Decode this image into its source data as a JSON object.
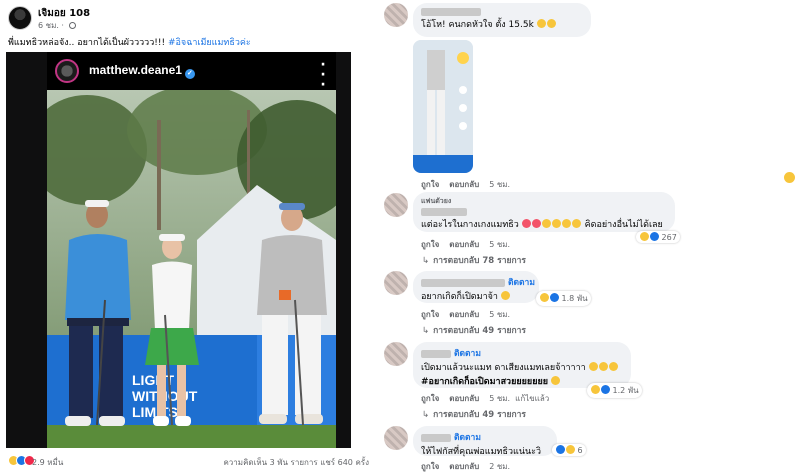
{
  "post": {
    "author": "เจิมอย 108",
    "time": "6 ชม.",
    "caption_text": "พี่แมทธิวหล่อจัง.. อยากได้เป็นผัววววว!!! ",
    "hashtag": "#อิจฉาเมียแมทธิวค่ะ",
    "ig_username": "matthew.deane1",
    "banner_line1": "LIGHT",
    "banner_line2": "WITHOUT",
    "banner_line3": "LIMITS",
    "reactions_count": "2.9 หมื่น",
    "stats": "ความคิดเห็น 3 พัน รายการ  แชร์ 640 ครั้ง"
  },
  "comments": [
    {
      "text": "โอ้โห! คนกดหัวใจ ตั้ง 15.5k",
      "like": "ถูกใจ",
      "reply": "ตอบกลับ",
      "time": "5 ชม."
    },
    {
      "badge": "แฟนตัวยง",
      "text": "แต่อะไรในกางเกงแมทธิว",
      "text_after": "คิดอย่างอื่นไม่ได้เลย",
      "reactions": "267",
      "like": "ถูกใจ",
      "reply": "ตอบกลับ",
      "time": "5 ชม.",
      "replies": "การตอบกลับ 78 รายการ"
    },
    {
      "follow": "ติดตาม",
      "text": "อยากเกิดก็เปิดมาจ้า",
      "reactions": "1.8 พัน",
      "like": "ถูกใจ",
      "reply": "ตอบกลับ",
      "time": "5 ชม.",
      "replies": "การตอบกลับ 49 รายการ"
    },
    {
      "follow": "ติดตาม",
      "text": "เปิดมาแล้วนะแมท ดาเสียงแมทเลยจ้าาาาา",
      "text2": "#อยากเกิดก็อเปิดมาสวยยยยยยย",
      "reactions": "1.2 พัน",
      "like": "ถูกใจ",
      "reply": "ตอบกลับ",
      "time": "5 ชม.",
      "edited": "แก้ไขแล้ว",
      "replies": "การตอบกลับ 49 รายการ"
    },
    {
      "follow": "ติดตาม",
      "text": "ให้ไฟกัสที่คุณพ่อแมทธิวแน่นะวิ",
      "reactions": "6",
      "like": "ถูกใจ",
      "reply": "ตอบกลับ",
      "time": "2 ชม."
    }
  ]
}
